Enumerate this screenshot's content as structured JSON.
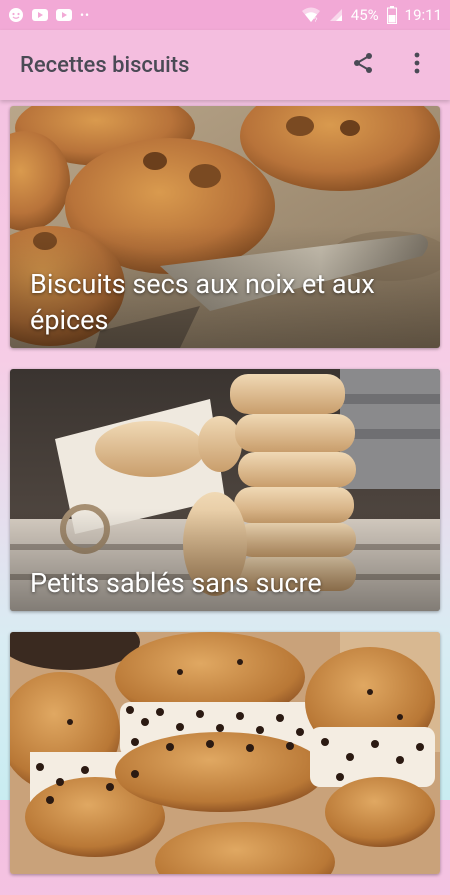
{
  "status_bar": {
    "battery": "45%",
    "time": "19:11",
    "icons": [
      "notification-icon",
      "youtube-icon",
      "youtube-icon",
      "more-dots-icon",
      "wifi-icon",
      "signal-icon",
      "battery-icon"
    ]
  },
  "app_bar": {
    "title": "Recettes biscuits",
    "actions": [
      "share-icon",
      "overflow-menu-icon"
    ]
  },
  "recipes": [
    {
      "title": "Biscuits secs aux noix et aux épices"
    },
    {
      "title": "Petits sablés sans sucre"
    },
    {
      "title": ""
    }
  ],
  "colors": {
    "status_bar": "#f2a9d6",
    "app_bar": "#f4bedf",
    "title_text": "#4a4a55"
  }
}
